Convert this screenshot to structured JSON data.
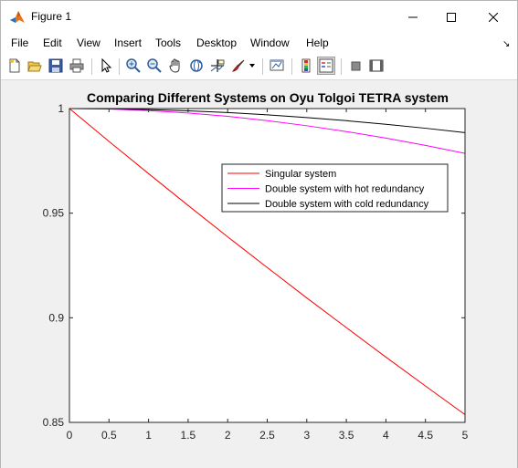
{
  "window": {
    "title": "Figure 1",
    "menu": [
      "File",
      "Edit",
      "View",
      "Insert",
      "Tools",
      "Desktop",
      "Window",
      "Help"
    ],
    "toolbar_icons": [
      "new-figure-icon",
      "open-file-icon",
      "save-icon",
      "print-icon",
      "pointer-icon",
      "zoom-in-icon",
      "zoom-out-icon",
      "pan-icon",
      "rotate-3d-icon",
      "data-cursor-icon",
      "brush-icon",
      "brush-dropdown-icon",
      "link-plot-icon",
      "colorbar-icon",
      "legend-icon",
      "hide-plot-tools-icon",
      "show-plot-tools-icon"
    ]
  },
  "chart_data": {
    "type": "line",
    "title": "Comparing Different Systems on Oyu Tolgoi TETRA system",
    "xlabel": "",
    "ylabel": "",
    "xlim": [
      0,
      5
    ],
    "ylim": [
      0.85,
      1
    ],
    "xticks": [
      0,
      0.5,
      1,
      1.5,
      2,
      2.5,
      3,
      3.5,
      4,
      4.5,
      5
    ],
    "xtick_labels": [
      "0",
      "0.5",
      "1",
      "1.5",
      "2",
      "2.5",
      "3",
      "3.5",
      "4",
      "4.5",
      "5"
    ],
    "yticks": [
      0.85,
      0.9,
      0.95,
      1
    ],
    "ytick_labels": [
      "0.85",
      "0.9",
      "0.95",
      "1"
    ],
    "grid": false,
    "legend_position": "upper-right",
    "series": [
      {
        "name": "Singular system",
        "color": "#ff0000",
        "x": [
          0,
          0.5,
          1,
          1.5,
          2,
          2.5,
          3,
          3.5,
          4,
          4.5,
          5
        ],
        "y": [
          1,
          0.9843,
          0.9689,
          0.9537,
          0.9387,
          0.924,
          0.9095,
          0.8953,
          0.8812,
          0.8674,
          0.8537
        ]
      },
      {
        "name": "Double system with hot redundancy",
        "color": "#ff00ff",
        "x": [
          0,
          0.5,
          1,
          1.5,
          2,
          2.5,
          3,
          3.5,
          4,
          4.5,
          5
        ],
        "y": [
          1,
          0.9998,
          0.999,
          0.9979,
          0.9963,
          0.9942,
          0.9918,
          0.989,
          0.9859,
          0.9824,
          0.9786
        ]
      },
      {
        "name": "Double system with cold redundancy",
        "color": "#000000",
        "x": [
          0,
          0.5,
          1,
          1.5,
          2,
          2.5,
          3,
          3.5,
          4,
          4.5,
          5
        ],
        "y": [
          1,
          0.9999,
          0.9995,
          0.9989,
          0.9981,
          0.997,
          0.9957,
          0.9942,
          0.9925,
          0.9906,
          0.9885
        ]
      }
    ]
  }
}
